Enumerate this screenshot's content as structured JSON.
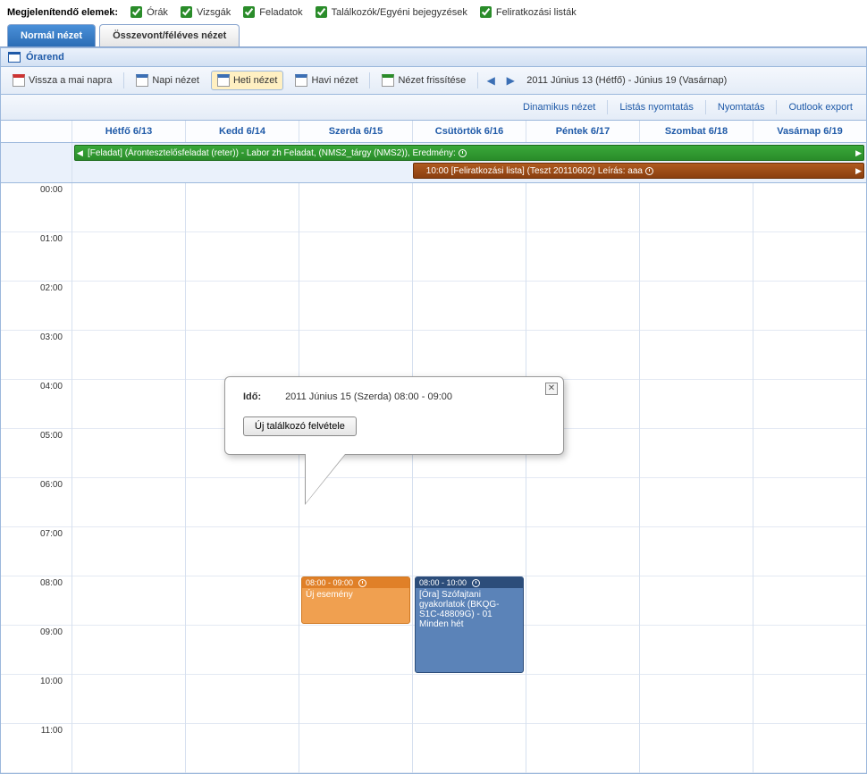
{
  "filters": {
    "label": "Megjelenítendő elemek:",
    "items": [
      {
        "label": "Órák",
        "checked": true
      },
      {
        "label": "Vizsgák",
        "checked": true
      },
      {
        "label": "Feladatok",
        "checked": true
      },
      {
        "label": "Találkozók/Egyéni bejegyzések",
        "checked": true
      },
      {
        "label": "Feliratkozási listák",
        "checked": true
      }
    ]
  },
  "tabs": {
    "normal": "Normál nézet",
    "aggregate": "Összevont/féléves nézet"
  },
  "panel_title": "Órarend",
  "toolbar": {
    "today": "Vissza a mai napra",
    "day_view": "Napi nézet",
    "week_view": "Heti nézet",
    "month_view": "Havi nézet",
    "refresh": "Nézet frissítése",
    "range": "2011 Június 13 (Hétfő) - Június 19 (Vasárnap)"
  },
  "toolbar2": {
    "dynamic": "Dinamikus nézet",
    "print_list": "Listás nyomtatás",
    "print": "Nyomtatás",
    "outlook": "Outlook export"
  },
  "days": [
    {
      "label": "Hétfő 6/13"
    },
    {
      "label": "Kedd 6/14"
    },
    {
      "label": "Szerda 6/15"
    },
    {
      "label": "Csütörtök 6/16"
    },
    {
      "label": "Péntek 6/17"
    },
    {
      "label": "Szombat 6/18"
    },
    {
      "label": "Vasárnap 6/19"
    }
  ],
  "allday": {
    "task": "[Feladat] (Árontesztelősfeladat (reter)) - Labor zh Feladat, (NMS2_tárgy (NMS2)), Eredmény:",
    "signup": "10:00 [Feliratkozási lista] (Teszt 20110602) Leírás: aaa"
  },
  "hours": [
    "00:00",
    "01:00",
    "02:00",
    "03:00",
    "04:00",
    "05:00",
    "06:00",
    "07:00",
    "08:00",
    "09:00",
    "10:00",
    "11:00"
  ],
  "events": {
    "new_event": {
      "time": "08:00 - 09:00",
      "title": "Új esemény"
    },
    "class": {
      "time": "08:00 - 10:00",
      "title": "[Óra] Szófajtani gyakorlatok (BKQG-S1C-48809G) - 01 Minden hét"
    }
  },
  "popup": {
    "time_label": "Idő:",
    "time_value": "2011 Június 15 (Szerda) 08:00 - 09:00",
    "button": "Új találkozó felvétele"
  }
}
